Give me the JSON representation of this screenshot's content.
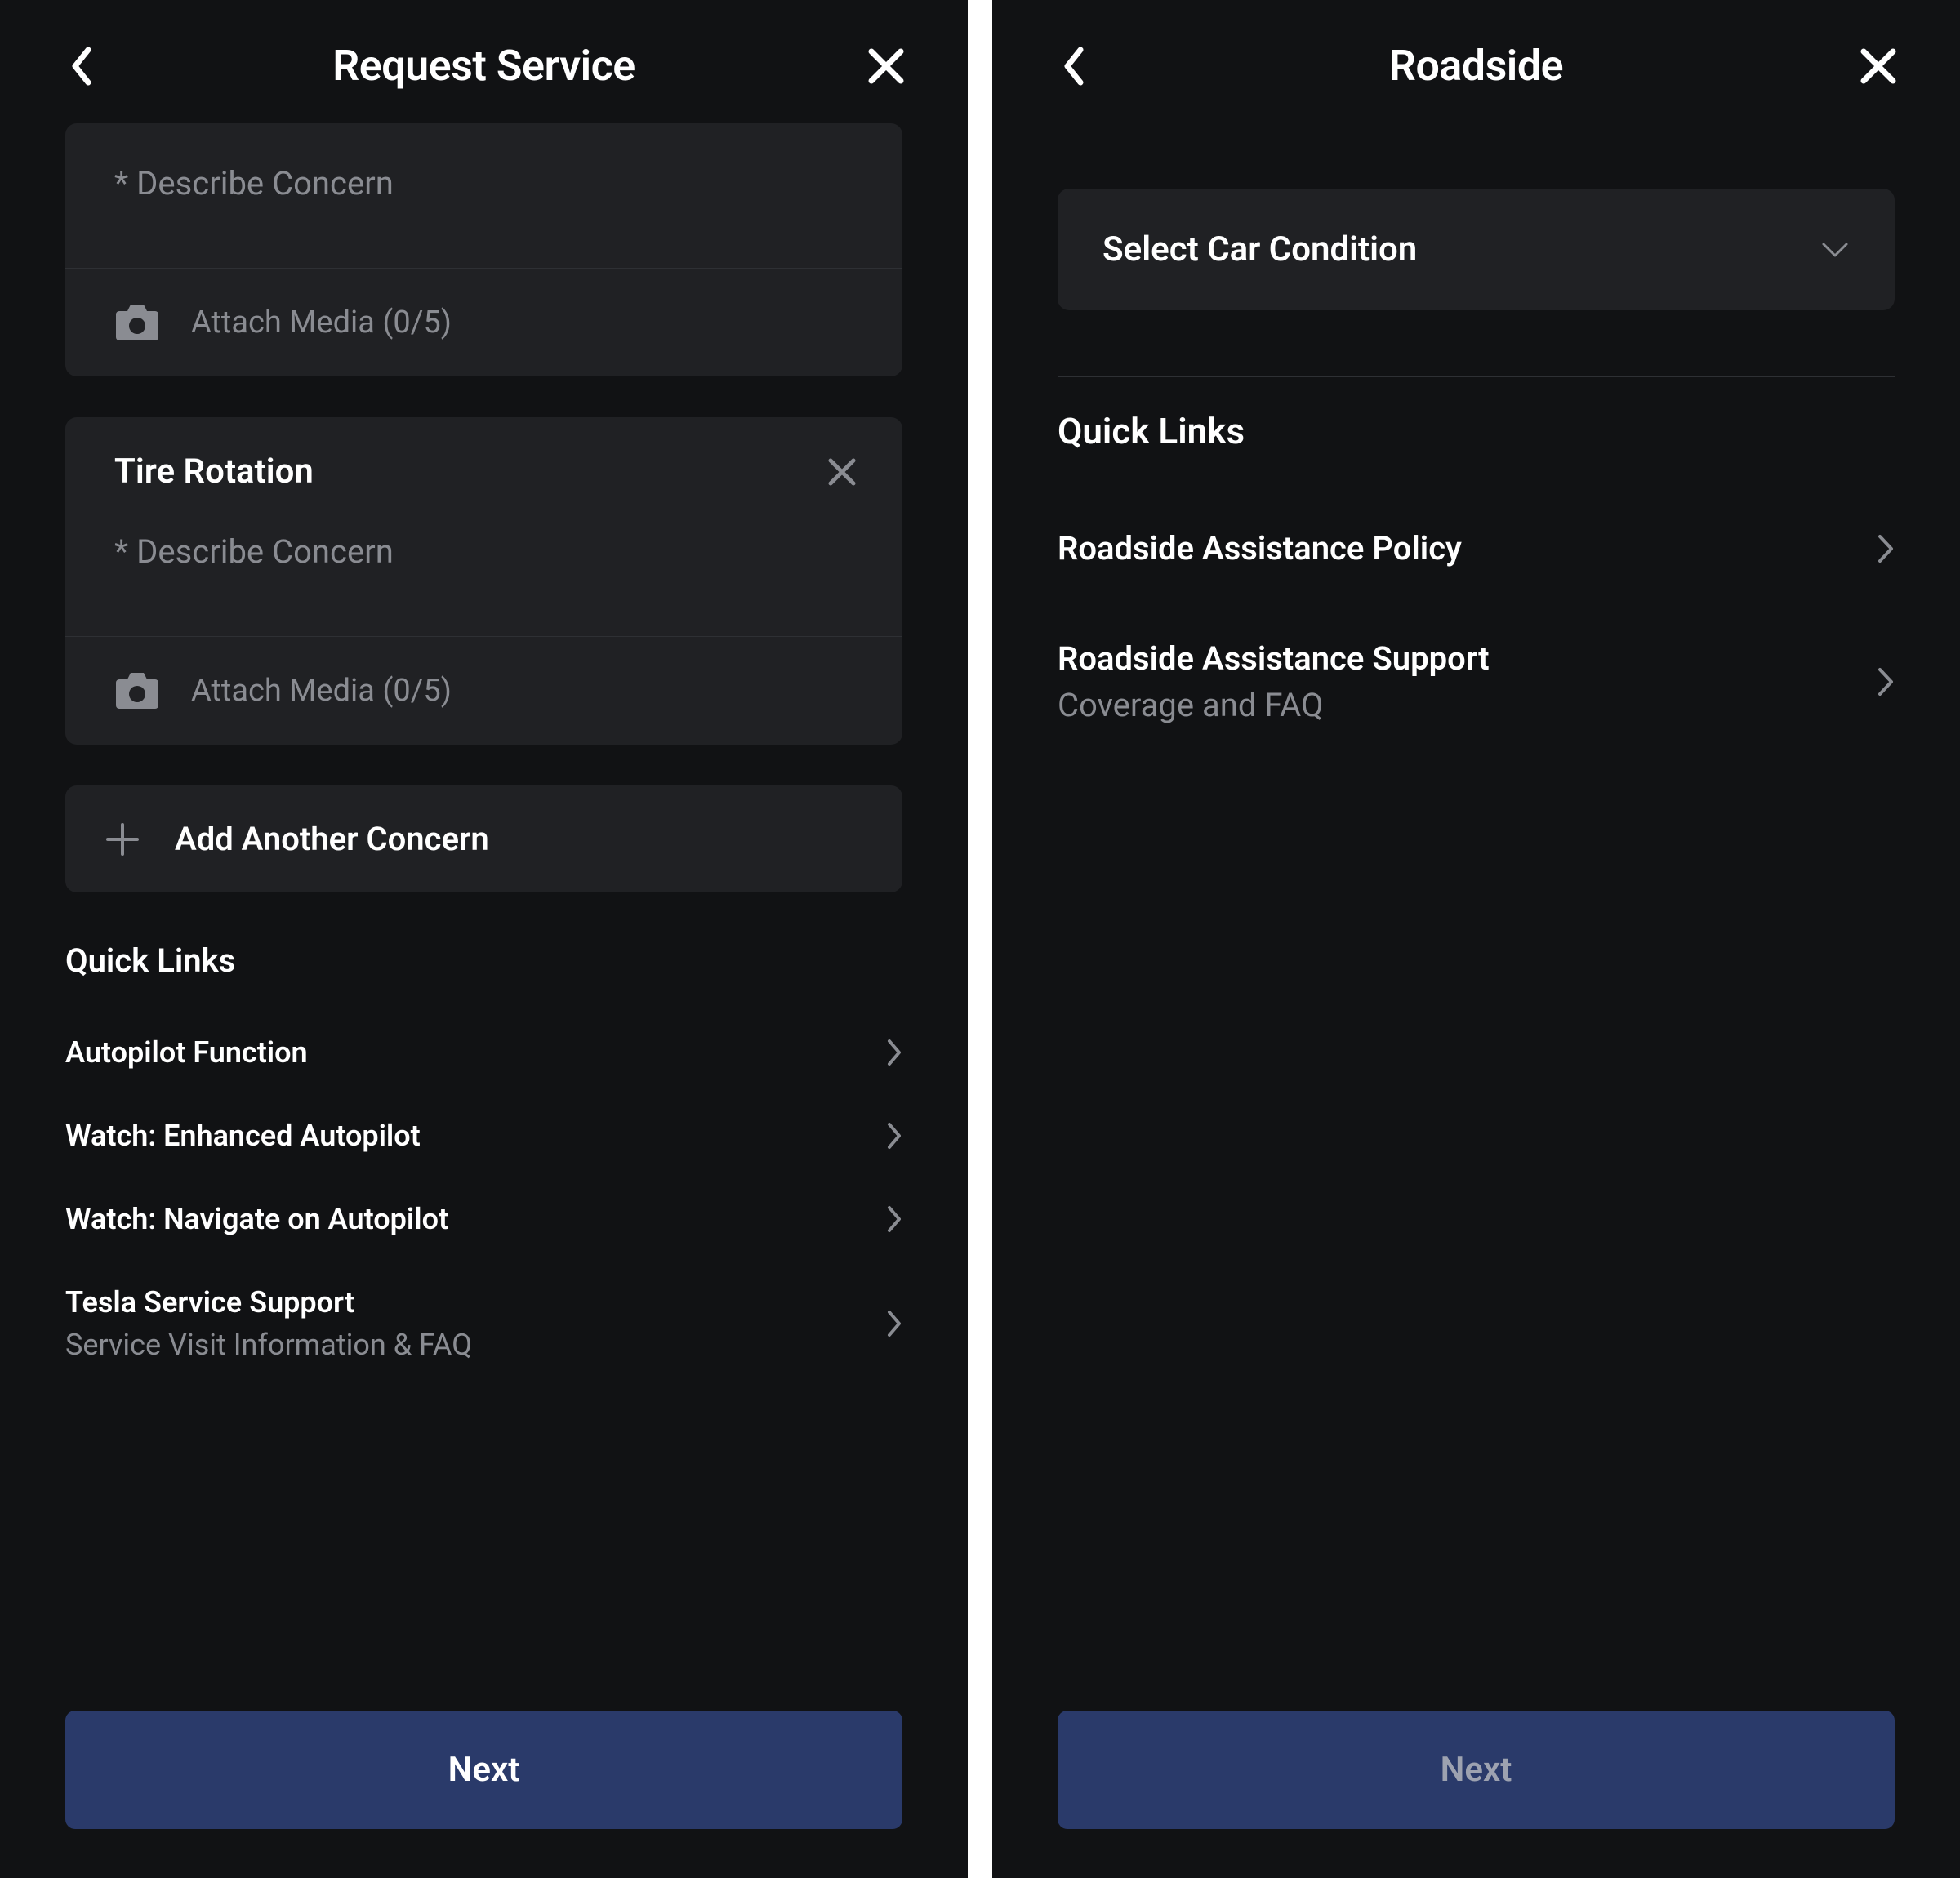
{
  "left": {
    "title": "Request Service",
    "concern1": {
      "placeholder": "* Describe Concern",
      "attach": "Attach Media (0/5)"
    },
    "concern2": {
      "title": "Tire Rotation",
      "placeholder": "* Describe Concern",
      "attach": "Attach Media (0/5)"
    },
    "addAnother": "Add Another Concern",
    "quickLinksTitle": "Quick Links",
    "links": [
      {
        "title": "Autopilot Function"
      },
      {
        "title": "Watch: Enhanced Autopilot"
      },
      {
        "title": "Watch: Navigate on Autopilot"
      },
      {
        "title": "Tesla Service Support",
        "sub": "Service Visit Information & FAQ"
      }
    ],
    "next": "Next"
  },
  "right": {
    "title": "Roadside",
    "selectLabel": "Select Car Condition",
    "quickLinksTitle": "Quick Links",
    "links": [
      {
        "title": "Roadside Assistance Policy"
      },
      {
        "title": "Roadside Assistance Support",
        "sub": "Coverage and FAQ"
      }
    ],
    "next": "Next"
  }
}
